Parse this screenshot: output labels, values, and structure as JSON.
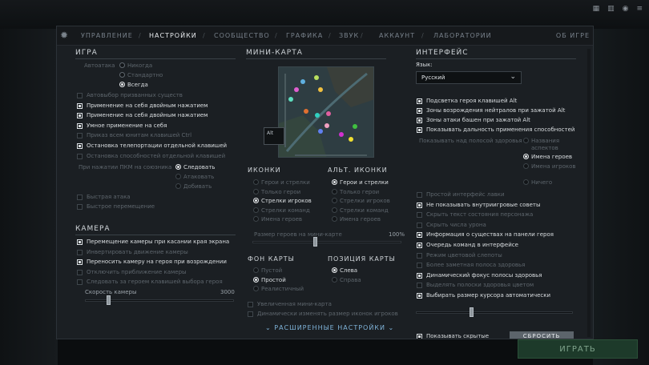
{
  "bottom_bar": {
    "play_label": "ИГРАТЬ"
  },
  "tabs": {
    "items": [
      "УПРАВЛЕНИЕ",
      "НАСТРОЙКИ",
      "СООБЩЕСТВО",
      "ГРАФИКА",
      "ЗВУК",
      "АККАУНТ",
      "ЛАБОРАТОРИИ"
    ],
    "active": "НАСТРОЙКИ",
    "about": "ОБ ИГРЕ"
  },
  "game": {
    "title": "ИГРА",
    "autoattack_label": "Автоатака",
    "autoattack_options": [
      "Никогда",
      "Стандартно",
      "Всегда"
    ],
    "autoattack_selected": "Всегда",
    "checks": [
      {
        "label": "Автовыбор призванных существ",
        "checked": false,
        "dim": true
      },
      {
        "label": "Применение на себя двойным нажатием",
        "checked": true,
        "dim": false
      },
      {
        "label": "Применение на себя двойным нажатием",
        "checked": true,
        "dim": false
      },
      {
        "label": "Умное применение на себя",
        "checked": true,
        "dim": false
      },
      {
        "label": "Приказ всем юнитам клавишей Ctrl",
        "checked": false,
        "dim": true
      },
      {
        "label": "Остановка телепортации отдельной клавишей",
        "checked": true,
        "dim": false
      },
      {
        "label": "Остановка способностей отдельной клавишей",
        "checked": false,
        "dim": true
      }
    ],
    "rmb_label": "При нажатии ПКМ на союзника",
    "rmb_options": [
      "Следовать",
      "Атаковать",
      "Добивать"
    ],
    "rmb_selected": "Следовать",
    "extra": [
      "Быстрая атака",
      "Быстрое перемещение"
    ]
  },
  "camera": {
    "title": "КАМЕРА",
    "checks": [
      {
        "label": "Перемещение камеры при касании края экрана",
        "checked": true,
        "dim": false
      },
      {
        "label": "Инвертировать движение камеры",
        "checked": false,
        "dim": true
      },
      {
        "label": "Переносить камеру на героя при возрождении",
        "checked": true,
        "dim": false
      },
      {
        "label": "Отключить приближение камеры",
        "checked": false,
        "dim": true
      },
      {
        "label": "Следовать за героем клавишей выбора героя",
        "checked": false,
        "dim": true
      }
    ],
    "speed_label": "Скорость камеры",
    "speed_value": "3000",
    "speed_fraction": 0.15
  },
  "minimap": {
    "title": "МИНИ-КАРТА",
    "alt_key": "Alt",
    "icons_title": "ИКОНКИ",
    "icons_options": [
      "Герои и стрелки",
      "Только герои",
      "Стрелки игроков",
      "Стрелки команд",
      "Имена героев"
    ],
    "icons_selected": "Стрелки игроков",
    "alt_icons_title": "АЛЬТ. ИКОНКИ",
    "alt_icons_options": [
      "Герои и стрелки",
      "Только герои",
      "Стрелки игроков",
      "Стрелки команд",
      "Имена героев"
    ],
    "alt_icons_selected": "Герои и стрелки",
    "size_label": "Размер героев на мини-карте",
    "size_value": "100%",
    "size_fraction": 0.42,
    "bg_title": "ФОН КАРТЫ",
    "bg_options": [
      "Пустой",
      "Простой",
      "Реалистичный"
    ],
    "bg_selected": "Простой",
    "pos_title": "ПОЗИЦИЯ КАРТЫ",
    "pos_options": [
      "Слева",
      "Справа"
    ],
    "pos_selected": "Слева",
    "bottom_checks": [
      "Увеличенная мини-карта",
      "Динамически изменять размер иконок игроков"
    ],
    "advanced": "РАСШИРЕННЫЕ НАСТРОЙКИ"
  },
  "interface": {
    "title": "ИНТЕРФЕЙС",
    "language_label": "Язык:",
    "language_value": "Русский",
    "checks_top": [
      {
        "label": "Подсветка героя клавишей Alt",
        "checked": true,
        "dim": false
      },
      {
        "label": "Зоны возрождения нейтралов при зажатой Alt",
        "checked": true,
        "dim": false
      },
      {
        "label": "Зоны атаки башен при зажатой Alt",
        "checked": true,
        "dim": false
      },
      {
        "label": "Показывать дальность применения способностей",
        "checked": true,
        "dim": false
      }
    ],
    "health_label": "Показывать над полосой здоровья",
    "health_options": [
      "Названия аспектов",
      "Имена героев",
      "Имена игроков",
      "Ничего"
    ],
    "health_selected": "Имена героев",
    "checks_bottom": [
      {
        "label": "Простой интерфейс лавки",
        "checked": false,
        "dim": true
      },
      {
        "label": "Не показывать внутриигровые советы",
        "checked": true,
        "dim": false
      },
      {
        "label": "Скрыть текст состояния персонажа",
        "checked": false,
        "dim": true
      },
      {
        "label": "Скрыть числа урона",
        "checked": false,
        "dim": true
      },
      {
        "label": "Информация о существах на панели героя",
        "checked": true,
        "dim": false
      },
      {
        "label": "Очередь команд в интерфейсе",
        "checked": true,
        "dim": false
      },
      {
        "label": "Режим цветовой слепоты",
        "checked": false,
        "dim": true
      },
      {
        "label": "Более заметная полоса здоровья",
        "checked": false,
        "dim": true
      },
      {
        "label": "Динамический фокус полосы здоровья",
        "checked": true,
        "dim": false
      },
      {
        "label": "Выделять полоски здоровья цветом",
        "checked": false,
        "dim": true
      },
      {
        "label": "Выбирать размер курсора автоматически",
        "checked": true,
        "dim": false
      }
    ],
    "cursor_fraction": 0.35,
    "show_hidden": "Показывать скрытые",
    "reset": "СБРОСИТЬ"
  }
}
